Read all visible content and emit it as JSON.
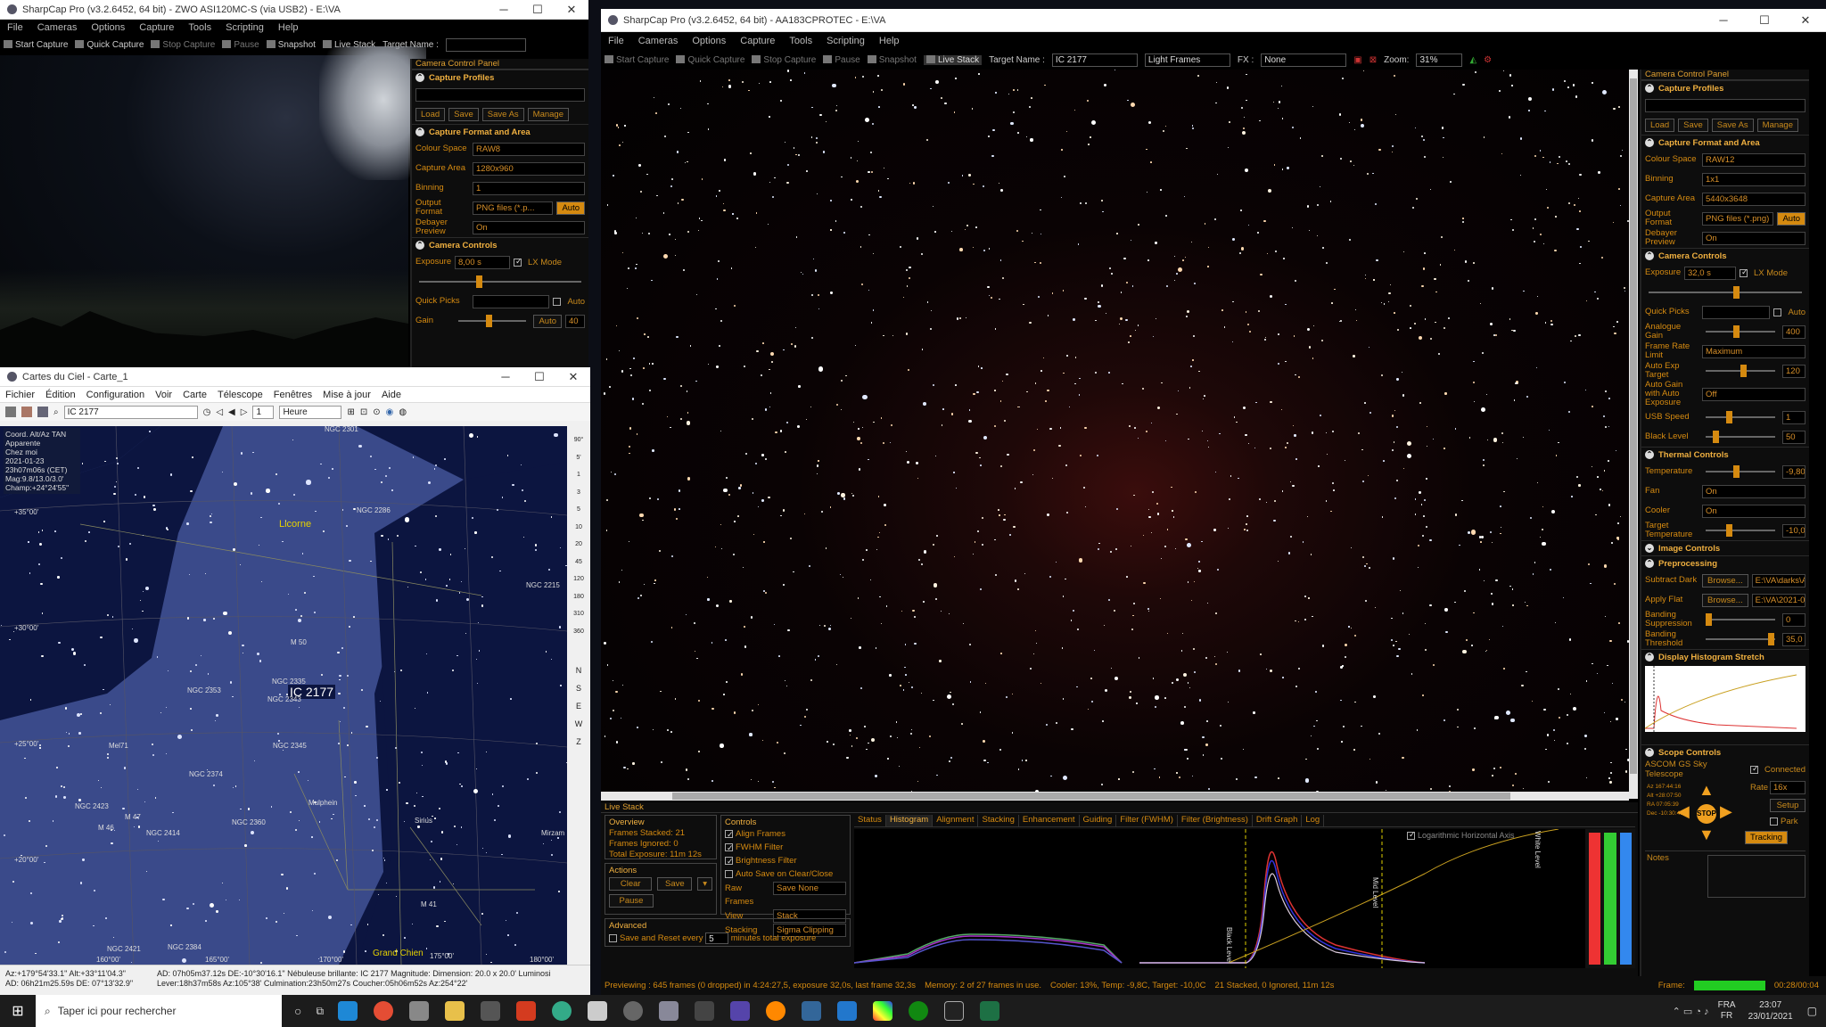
{
  "sc_small": {
    "title": "SharpCap Pro (v3.2.6452, 64 bit) - ZWO ASI120MC-S (via USB2) - E:\\VA",
    "menus": [
      "File",
      "Cameras",
      "Options",
      "Capture",
      "Tools",
      "Scripting",
      "Help"
    ],
    "toolbar": {
      "start": "Start Capture",
      "quick": "Quick Capture",
      "stop": "Stop Capture",
      "pause": "Pause",
      "snapshot": "Snapshot",
      "livestack": "Live Stack",
      "target_label": "Target Name :"
    },
    "panel": {
      "caption": "Camera Control Panel",
      "profiles": "Capture Profiles",
      "load": "Load",
      "save": "Save",
      "saveas": "Save As",
      "manage": "Manage",
      "format_area": "Capture Format and Area",
      "colour_space_label": "Colour Space",
      "colour_space": "RAW8",
      "capture_area_label": "Capture Area",
      "capture_area": "1280x960",
      "binning_label": "Binning",
      "binning": "1",
      "output_label": "Output Format",
      "output": "PNG files (*.p...",
      "auto": "Auto",
      "debayer_label": "Debayer Preview",
      "debayer": "On",
      "camera_controls": "Camera Controls",
      "exposure_label": "Exposure",
      "exposure": "8,00 s",
      "lx": "LX Mode",
      "quickpicks_label": "Quick Picks",
      "gain_label": "Gain",
      "gain": "40",
      "auto2": "Auto"
    }
  },
  "cdc": {
    "title": "Cartes du Ciel - Carte_1",
    "menus": [
      "Fichier",
      "Édition",
      "Configuration",
      "Voir",
      "Carte",
      "Télescope",
      "Fenêtres",
      "Mise à jour",
      "Aide"
    ],
    "search": "IC 2177",
    "step": "1",
    "unit": "Heure",
    "info": [
      "Coord. Alt/Az TAN",
      "Apparente",
      "Chez moi",
      "2021-01-23",
      "23h07m06s (CET)",
      "Mag:9.8/13.0/3.0'",
      "Champ:+24°24'55\""
    ],
    "labels": {
      "ngc2301": "NGC 2301",
      "ngc2286": "NGC 2286",
      "licorne": "Licorne",
      "ngc2215": "NGC 2215",
      "m50": "M 50",
      "ngc2335": "NGC 2335",
      "ic2177": "IC 2177",
      "ngc2343": "NGC 2343",
      "ngc2353": "NGC 2353",
      "mel71": "Mel71",
      "ngc2345": "NGC 2345",
      "ngc2374": "NGC 2374",
      "mulphein": "Mulphein",
      "ngc2423": "NGC 2423",
      "m47": "M 47",
      "m46": "M 46",
      "ngc2414": "NGC 2414",
      "ngc2360": "NGC 2360",
      "sirius": "Sirius",
      "mirzam": "Mirzam",
      "m41": "M 41",
      "grandchien": "Grand Chien",
      "ngc2384": "NGC 2384",
      "ngc2421": "NGC 2421"
    },
    "grid": {
      "d35": "+35°00'",
      "d30": "+30°00'",
      "d25": "+25°00'",
      "d20": "+20°00'",
      "r160": "160°00'",
      "r165": "165°00'",
      "r170": "170°00'",
      "r175": "175°00'",
      "r180": "180°00'"
    },
    "scale": [
      "90°",
      "5'",
      "1",
      "3",
      "5",
      "10",
      "20",
      "45",
      "120",
      "180",
      "310",
      "360"
    ],
    "side": [
      "N",
      "S",
      "E",
      "W",
      "Z"
    ],
    "status1": "Az:+179°54'33.1\" Alt:+33°11'04.3\"",
    "status2": "AD: 06h21m25.59s DE: 07°13'32.9\"",
    "status3": "AD: 07h05m37.12s DE:-10°30'16.1\"  Nébuleuse brillante: IC 2177  Magnitude:   Dimension:  20.0 x 20.0'  Luminosi",
    "status4": "Lever:18h37m58s Az:105°38'  Culmination:23h50m27s  Coucher:05h06m52s Az:254°22'"
  },
  "sc_big": {
    "title": "SharpCap Pro (v3.2.6452, 64 bit) - AA183CPROTEC - E:\\VA",
    "menus": [
      "File",
      "Cameras",
      "Options",
      "Capture",
      "Tools",
      "Scripting",
      "Help"
    ],
    "toolbar": {
      "start": "Start Capture",
      "quick": "Quick Capture",
      "stop": "Stop Capture",
      "pause": "Pause",
      "snapshot": "Snapshot",
      "livestack": "Live Stack",
      "target_label": "Target Name :",
      "target": "IC 2177",
      "frames": "Light Frames",
      "fx_label": "FX :",
      "fx": "None",
      "zoom_label": "Zoom:",
      "zoom": "31%"
    },
    "panel": {
      "caption": "Camera Control Panel",
      "profiles": "Capture Profiles",
      "load": "Load",
      "save": "Save",
      "saveas": "Save As",
      "manage": "Manage",
      "format_area": "Capture Format and Area",
      "colour_space_label": "Colour Space",
      "colour_space": "RAW12",
      "binning_label": "Binning",
      "binning": "1x1",
      "capture_area_label": "Capture Area",
      "capture_area": "5440x3648",
      "output_label": "Output Format",
      "output": "PNG files (*.png)",
      "auto": "Auto",
      "debayer_label": "Debayer Preview",
      "debayer": "On",
      "camera_controls": "Camera Controls",
      "exposure_label": "Exposure",
      "exposure": "32,0 s",
      "lx": "LX Mode",
      "quickpicks_label": "Quick Picks",
      "auto2": "Auto",
      "gain_label": "Analogue Gain",
      "gain": "400",
      "frl_label": "Frame Rate Limit",
      "frl": "Maximum",
      "aet_label": "Auto Exp Target",
      "aet": "120",
      "ag_label": "Auto Gain with Auto Exposure",
      "ag": "Off",
      "usb_label": "USB Speed",
      "usb": "1",
      "bl_label": "Black Level",
      "bl": "50",
      "thermal": "Thermal Controls",
      "temp_label": "Temperature",
      "temp": "-9,80",
      "fan_label": "Fan",
      "fan": "On",
      "cooler_label": "Cooler",
      "cooler": "On",
      "tt_label": "Target Temperature",
      "tt": "-10,0",
      "image_controls": "Image Controls",
      "preprocessing": "Preprocessing",
      "dark_label": "Subtract Dark",
      "dark": "E:\\VA\\darks\\A...",
      "flat_label": "Apply Flat",
      "flat": "E:\\VA\\2021-01...",
      "browse": "Browse...",
      "bs_label": "Banding Suppression",
      "bs": "0",
      "bt_label": "Banding Threshold",
      "bt": "35,0",
      "histo": "Display Histogram Stretch",
      "scope": "Scope Controls",
      "scope_name": "ASCOM GS Sky Telescope",
      "connected": "Connected",
      "rate_label": "Rate",
      "rate": "16x",
      "setup": "Setup",
      "park": "Park",
      "stop": "STOP",
      "tracking": "Tracking",
      "notes": "Notes",
      "coords": [
        "Az 167:44:16",
        "Alt +28:07:50",
        "RA 07:05:39",
        "Dec -10:30:46"
      ]
    },
    "livestack": {
      "caption": "Live Stack",
      "overview": "Overview",
      "stacked": "Frames Stacked: 21",
      "ignored": "Frames Ignored: 0",
      "total": "Total Exposure:  11m 12s",
      "actions": "Actions",
      "clear": "Clear",
      "save": "Save",
      "pause": "Pause",
      "controls": "Controls",
      "align": "Align Frames",
      "fwhm": "FWHM Filter",
      "bright": "Brightness Filter",
      "autosave": "Auto Save on Clear/Close",
      "raw_label": "Raw Frames",
      "raw": "Save None",
      "view_label": "View",
      "view": "Stack",
      "stacking_label": "Stacking",
      "stacking": "Sigma Clipping",
      "advanced": "Advanced",
      "saveevery": "Save and Reset every",
      "minutes": "5",
      "mintext": "minutes total exposure",
      "tabs": [
        "Status",
        "Histogram",
        "Alignment",
        "Stacking",
        "Enhancement",
        "Guiding",
        "Filter (FWHM)",
        "Filter (Brightness)",
        "Drift Graph",
        "Log"
      ],
      "loglabel": "Logarithmic Horizontal Axis",
      "blacklevel": "Black Level",
      "midlevel": "Mid Level",
      "whitelevel": "White Level"
    },
    "status": {
      "preview": "Previewing : 645 frames (0 dropped) in 4:24:27,5, exposure 32,0s, last frame 32,3s",
      "memory": "Memory: 2 of 27 frames in use.",
      "cooler": "Cooler: 13%, Temp: -9,8C, Target: -10,0C",
      "stack": "21 Stacked, 0 Ignored, 11m 12s",
      "frame_label": "Frame:",
      "frame": "00:28/00:04"
    }
  },
  "taskbar": {
    "search": "Taper ici pour rechercher",
    "lang1": "FRA",
    "lang2": "FR",
    "time": "23:07",
    "date": "23/01/2021"
  }
}
